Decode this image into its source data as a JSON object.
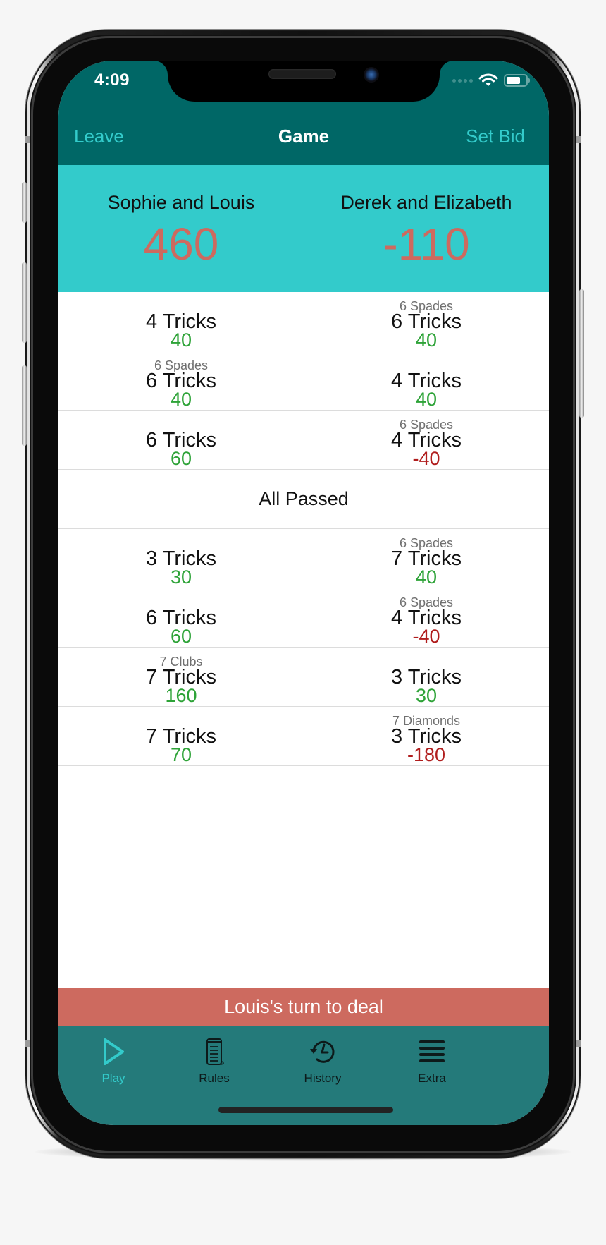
{
  "status_bar": {
    "time": "4:09",
    "icons": [
      "signal-icon",
      "wifi-icon",
      "battery-icon"
    ]
  },
  "nav": {
    "left_label": "Leave",
    "title": "Game",
    "right_label": "Set Bid"
  },
  "teams": [
    {
      "name": "Sophie and Louis",
      "score": "460"
    },
    {
      "name": "Derek and Elizabeth",
      "score": "-110"
    }
  ],
  "rounds": [
    {
      "type": "play",
      "left": {
        "bid": "",
        "tricks": "4 Tricks",
        "points": "40",
        "sign": "pos"
      },
      "right": {
        "bid": "6 Spades",
        "tricks": "6 Tricks",
        "points": "40",
        "sign": "pos"
      }
    },
    {
      "type": "play",
      "left": {
        "bid": "6 Spades",
        "tricks": "6 Tricks",
        "points": "40",
        "sign": "pos"
      },
      "right": {
        "bid": "",
        "tricks": "4 Tricks",
        "points": "40",
        "sign": "pos"
      }
    },
    {
      "type": "play",
      "left": {
        "bid": "",
        "tricks": "6 Tricks",
        "points": "60",
        "sign": "pos"
      },
      "right": {
        "bid": "6 Spades",
        "tricks": "4 Tricks",
        "points": "-40",
        "sign": "neg"
      }
    },
    {
      "type": "passed",
      "label": "All Passed"
    },
    {
      "type": "play",
      "left": {
        "bid": "",
        "tricks": "3 Tricks",
        "points": "30",
        "sign": "pos"
      },
      "right": {
        "bid": "6 Spades",
        "tricks": "7 Tricks",
        "points": "40",
        "sign": "pos"
      }
    },
    {
      "type": "play",
      "left": {
        "bid": "",
        "tricks": "6 Tricks",
        "points": "60",
        "sign": "pos"
      },
      "right": {
        "bid": "6 Spades",
        "tricks": "4 Tricks",
        "points": "-40",
        "sign": "neg"
      }
    },
    {
      "type": "play",
      "left": {
        "bid": "7 Clubs",
        "tricks": "7 Tricks",
        "points": "160",
        "sign": "pos"
      },
      "right": {
        "bid": "",
        "tricks": "3 Tricks",
        "points": "30",
        "sign": "pos"
      }
    },
    {
      "type": "play",
      "left": {
        "bid": "",
        "tricks": "7 Tricks",
        "points": "70",
        "sign": "pos"
      },
      "right": {
        "bid": "7 Diamonds",
        "tricks": "3 Tricks",
        "points": "-180",
        "sign": "neg"
      }
    }
  ],
  "dealer_banner": "Louis's turn to deal",
  "tabs": [
    {
      "label": "Play",
      "icon": "play-icon",
      "active": true
    },
    {
      "label": "Rules",
      "icon": "scroll-icon",
      "active": false
    },
    {
      "label": "History",
      "icon": "history-icon",
      "active": false
    },
    {
      "label": "Extra",
      "icon": "menu-icon",
      "active": false
    }
  ],
  "colors": {
    "header": "#006766",
    "accent": "#33cbcb",
    "score": "#cd6a5f",
    "positive": "#2ea338",
    "negative": "#b01d1d",
    "dealer_banner": "#cd6a5f",
    "tabbar": "#247a7a"
  }
}
